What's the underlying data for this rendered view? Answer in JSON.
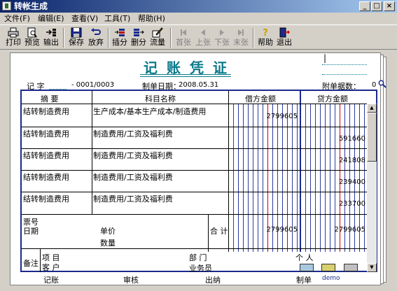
{
  "window": {
    "title": "转帐生成",
    "minimize": "_",
    "maximize": "□",
    "close": "×"
  },
  "menu": [
    {
      "label": "文件(F)"
    },
    {
      "label": "编辑(E)"
    },
    {
      "label": "查看(V)"
    },
    {
      "label": "工具(T)"
    },
    {
      "label": "帮助(H)"
    }
  ],
  "toolbar": {
    "print": "打印",
    "preview": "预览",
    "export": "输出",
    "save": "保存",
    "discard": "放弃",
    "insert_row": "插分",
    "delete_row": "删分",
    "cashflow": "流量",
    "first": "首张",
    "prev": "上张",
    "next": "下张",
    "last": "末张",
    "help": "帮助",
    "exit": "退出"
  },
  "voucher": {
    "title": "记账凭证",
    "cursor": "|",
    "type_label": "记  字",
    "number": "- 0001/0003",
    "date_label": "制单日期：",
    "date": "2008.05.31",
    "attachments_label": "附单据数：",
    "attachments": "0",
    "headers": {
      "summary": "摘  要",
      "account": "科目名称",
      "debit": "借方金额",
      "credit": "贷方金额"
    },
    "rows": [
      {
        "summary": "结转制造费用",
        "account": "生产成本/基本生产成本/制造费用",
        "debit": "2799605",
        "credit": ""
      },
      {
        "summary": "结转制造费用",
        "account": "制造费用/工资及福利费",
        "debit": "",
        "credit": "591660"
      },
      {
        "summary": "结转制造费用",
        "account": "制造费用/工资及福利费",
        "debit": "",
        "credit": "241808"
      },
      {
        "summary": "结转制造费用",
        "account": "制造费用/工资及福利费",
        "debit": "",
        "credit": "239400"
      },
      {
        "summary": "结转制造费用",
        "account": "制造费用/工资及福利费",
        "debit": "",
        "credit": "233700"
      }
    ],
    "footer": {
      "ticket_no": "票号",
      "date": "日期",
      "unit_price": "单价",
      "quantity": "数量",
      "total_label": "合 计",
      "total_debit": "2799605",
      "total_credit": "2799605",
      "remark": "备注",
      "project": "项  目",
      "customer": "客  户",
      "department": "部  门",
      "clerk": "业务员",
      "person": "个  人"
    },
    "signatures": {
      "bookkeeper": "记账",
      "reviewer": "审核",
      "cashier": "出纳",
      "preparer": "制单",
      "preparer_name": "demo"
    }
  },
  "colors": {
    "accent": "#0a7a8a",
    "table_border": "#1b2a8c",
    "divider_red": "#d00000",
    "divider_blue": "#2d3ba0"
  }
}
